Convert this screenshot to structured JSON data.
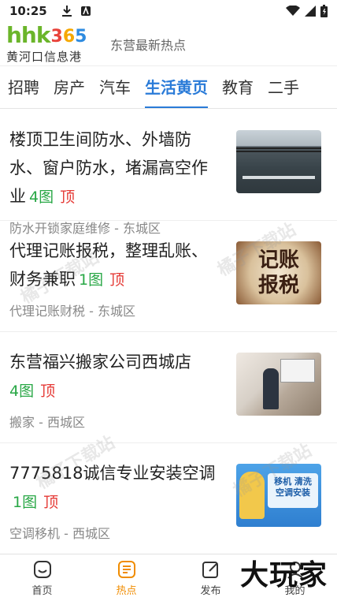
{
  "status": {
    "time": "10:25",
    "icons": [
      "download-icon",
      "app-notification-icon",
      "wifi-icon",
      "signal-icon",
      "battery-icon"
    ]
  },
  "header": {
    "logo_hhk": "hhk",
    "logo_digits": [
      "3",
      "6",
      "5"
    ],
    "logo_subtitle": "黄河口信息港",
    "title": "东营最新热点"
  },
  "tabs": [
    {
      "label": "招聘",
      "active": false
    },
    {
      "label": "房产",
      "active": false
    },
    {
      "label": "汽车",
      "active": false
    },
    {
      "label": "生活黄页",
      "active": true
    },
    {
      "label": "教育",
      "active": false
    },
    {
      "label": "二手",
      "active": false
    }
  ],
  "listings": [
    {
      "title": "楼顶卫生间防水、外墙防水、窗户防水，堵漏高空作业",
      "image_count": "4图",
      "top_tag": "顶",
      "meta": "防水开锁家庭维修 - 东城区"
    },
    {
      "title": "代理记账报税，整理乱账、财务兼职",
      "image_count": "1图",
      "top_tag": "顶",
      "meta": "代理记账财税 - 东城区",
      "thumb_text_1": "记账",
      "thumb_text_2": "报税"
    },
    {
      "title": "东营福兴搬家公司西城店",
      "image_count": "4图",
      "top_tag": "顶",
      "meta": "搬家 - 西城区"
    },
    {
      "title": "7775818诚信专业安装空调",
      "image_count": "1图",
      "top_tag": "顶",
      "meta": "空调移机 - 西城区",
      "thumb_text_1": "移机 清洗",
      "thumb_text_2": "空调安装"
    }
  ],
  "watermark_text": "橘子下载站",
  "bottom_nav": [
    {
      "label": "首页",
      "icon": "home-icon",
      "active": false
    },
    {
      "label": "热点",
      "icon": "hot-news-icon",
      "active": true
    },
    {
      "label": "发布",
      "icon": "edit-icon",
      "active": false
    },
    {
      "label": "我的",
      "icon": "profile-icon",
      "active": false
    }
  ],
  "brand_watermark": "大玩家",
  "colors": {
    "accent": "#2a7bd8",
    "count_green": "#28a745",
    "top_red": "#e53935",
    "nav_active": "#f08c00"
  }
}
